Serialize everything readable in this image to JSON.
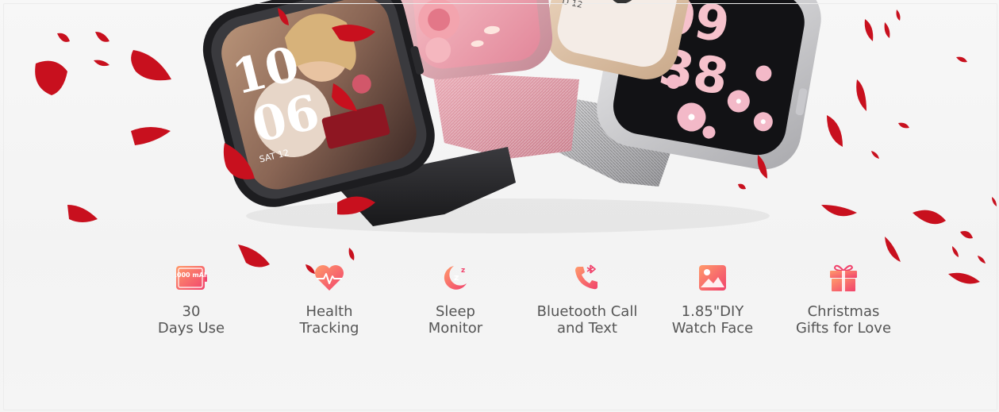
{
  "colors": {
    "background": "#f4f4f4",
    "icon_gradient_start": "#ff9a6b",
    "icon_gradient_end": "#f1436c",
    "petal": "#c8101e",
    "text": "#555555"
  },
  "hero": {
    "watch_faces": [
      {
        "name": "photo-watch",
        "time_hour": "10",
        "time_minute": "06",
        "day": "SAT 12"
      },
      {
        "name": "rose-watch"
      },
      {
        "name": "gold-watch"
      },
      {
        "name": "floral-watch",
        "time_hour": "09",
        "time_minute": "38"
      }
    ]
  },
  "features": [
    {
      "icon": "battery-1000mah-icon",
      "icon_text": "1000 mAh",
      "line1": "30",
      "line2": "Days Use"
    },
    {
      "icon": "heart-rate-icon",
      "line1": "Health",
      "line2": "Tracking"
    },
    {
      "icon": "sleep-moon-icon",
      "line1": "Sleep",
      "line2": "Monitor"
    },
    {
      "icon": "bluetooth-call-icon",
      "line1": "Bluetooth Call",
      "line2": "and Text"
    },
    {
      "icon": "image-icon",
      "line1": "1.85\"DIY",
      "line2": "Watch Face"
    },
    {
      "icon": "gift-icon",
      "line1": "Christmas",
      "line2": "Gifts for Love"
    }
  ]
}
